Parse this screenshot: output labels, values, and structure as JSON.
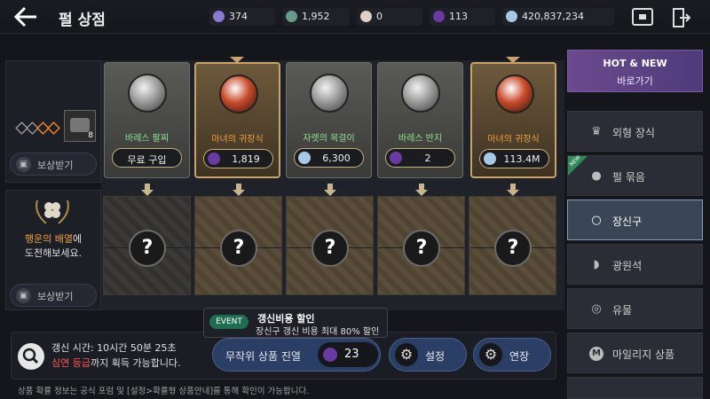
{
  "header": {
    "title": "펄 상점",
    "currencies": [
      {
        "icon": "mileage-icon",
        "value": "374",
        "color": "#8a7ad0"
      },
      {
        "icon": "crystal-icon",
        "value": "1,952",
        "color": "#6a9a8a"
      },
      {
        "icon": "pearl-icon",
        "value": "0",
        "color": "#e0d0c8"
      },
      {
        "icon": "purple-gem-icon",
        "value": "113",
        "color": "#6a3aa0"
      },
      {
        "icon": "silver-coin-icon",
        "value": "420,837,234",
        "color": "#a8c8e8"
      }
    ]
  },
  "left": {
    "reward_label_top": "보상받기",
    "reward_label_bottom": "보상받기",
    "badge_count": "8",
    "lucky_line1_highlight": "행운의 배열",
    "lucky_line1_rest": "에",
    "lucky_line2": "도전해보세요."
  },
  "products": [
    {
      "name": "바레스 팔찌",
      "price": "무료 구입",
      "price_icon": "",
      "style": "gray",
      "name_color": "green"
    },
    {
      "name": "마녀의 귀장식",
      "price": "1,819",
      "price_icon": "purple-gem-icon",
      "style": "gold",
      "name_color": "orange"
    },
    {
      "name": "자렛의 목걸이",
      "price": "6,300",
      "price_icon": "silver-coin-icon",
      "style": "gray",
      "name_color": "green"
    },
    {
      "name": "바레스 반지",
      "price": "2",
      "price_icon": "purple-gem-icon",
      "style": "gray",
      "name_color": "green"
    },
    {
      "name": "마녀의 귀장식",
      "price": "113.4M",
      "price_icon": "silver-coin-icon",
      "style": "gold",
      "name_color": "orange"
    }
  ],
  "mystery_mark": "?",
  "bottom": {
    "refresh_time": "갱신 시간: 10시간 50분 25초",
    "grade_highlight": "심연 등급",
    "grade_rest": "까지 획득 가능합니다.",
    "random_label": "무작위 상품 진열",
    "random_count": "23",
    "settings_label": "설정",
    "extend_label": "연장",
    "event_badge": "EVENT",
    "event_title": "갱신비용 할인",
    "event_desc": "장신구 갱신 비용 최대 80% 할인"
  },
  "sidebar": {
    "hot_title": "HOT & NEW",
    "hot_sub": "바로가기",
    "new_tag": "NEW",
    "items": [
      {
        "label": "외형 장식",
        "icon": "crown-icon",
        "active": false
      },
      {
        "label": "펄 묶음",
        "icon": "pearl-bundle-icon",
        "active": false
      },
      {
        "label": "장신구",
        "icon": "ring-icon",
        "active": true
      },
      {
        "label": "광원석",
        "icon": "ore-icon",
        "active": false
      },
      {
        "label": "유물",
        "icon": "relic-icon",
        "active": false
      },
      {
        "label": "마일리지 상품",
        "icon": "mileage-icon",
        "active": false
      }
    ]
  },
  "footnote": "상품 확률 정보는 공식 포럼 및 [설정>확률형 상품안내]를 통해 확인이 가능합니다."
}
